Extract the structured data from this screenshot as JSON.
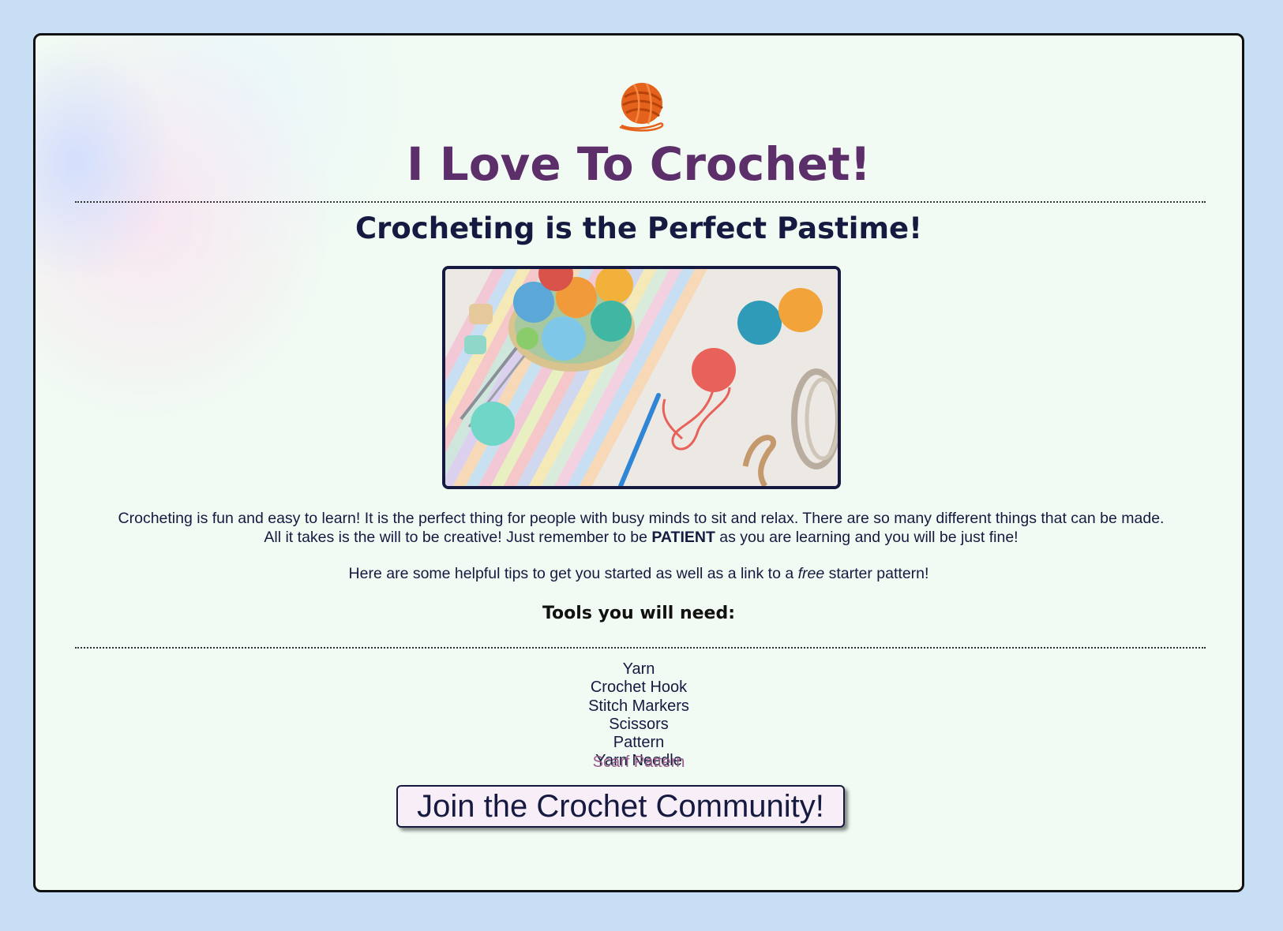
{
  "header": {
    "logo_icon": "yarn-ball-icon",
    "title": "I Love To Crochet!",
    "subtitle": "Crocheting is the Perfect Pastime!"
  },
  "hero_image": {
    "description_icon": "yarn-balls-photo"
  },
  "intro": {
    "part1": "Crocheting is fun and easy to learn! It is the perfect thing for people with busy minds to sit and relax. There are so many different things that can be made. All it takes is the will to be creative! Just remember to be ",
    "emphasis": "PATIENT",
    "part2": " as you are learning and you will be just fine!"
  },
  "tips": {
    "before": "Here are some helpful tips to get you started as well as a link to a ",
    "italic": "free",
    "after": " starter pattern!"
  },
  "tools": {
    "heading": "Tools you will need:",
    "items": [
      "Yarn",
      "Crochet Hook",
      "Stitch Markers",
      "Scissors",
      "Pattern",
      "Yarn Needle"
    ],
    "link_label": "Scarf Pattern"
  },
  "cta": {
    "label": "Join the Crochet Community!"
  },
  "colors": {
    "page_background": "#c7def5",
    "card_background": "#f1faf3",
    "title": "#5c2f6b",
    "text": "#161a40",
    "link": "#9a5e8a",
    "button_background": "#f7eef7"
  }
}
